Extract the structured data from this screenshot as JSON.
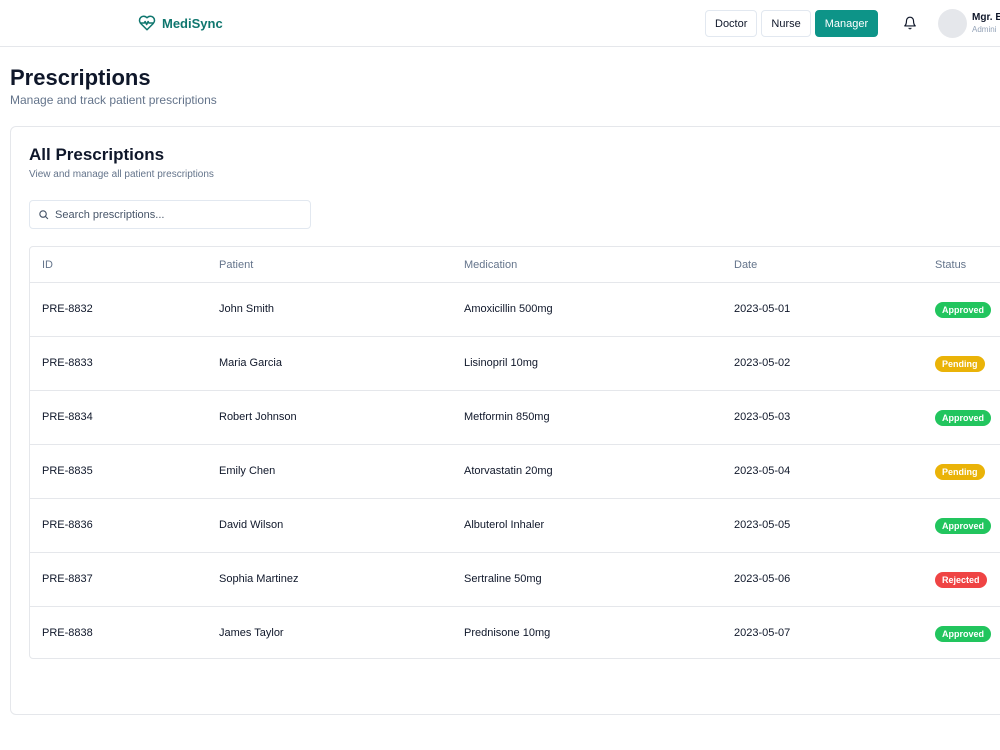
{
  "header": {
    "brand": "MediSync",
    "roles": [
      {
        "label": "Doctor",
        "active": false
      },
      {
        "label": "Nurse",
        "active": false
      },
      {
        "label": "Manager",
        "active": true
      }
    ],
    "user_name": "Mgr. E",
    "user_role": "Admini"
  },
  "page": {
    "title": "Prescriptions",
    "subtitle": "Manage and track patient prescriptions"
  },
  "card": {
    "title": "All Prescriptions",
    "subtitle": "View and manage all patient prescriptions",
    "search_placeholder": "Search prescriptions..."
  },
  "table": {
    "columns": [
      "ID",
      "Patient",
      "Medication",
      "Date",
      "Status"
    ],
    "rows": [
      {
        "id": "PRE-8832",
        "patient": "John Smith",
        "medication": "Amoxicillin 500mg",
        "date": "2023-05-01",
        "status": "Approved"
      },
      {
        "id": "PRE-8833",
        "patient": "Maria Garcia",
        "medication": "Lisinopril 10mg",
        "date": "2023-05-02",
        "status": "Pending"
      },
      {
        "id": "PRE-8834",
        "patient": "Robert Johnson",
        "medication": "Metformin 850mg",
        "date": "2023-05-03",
        "status": "Approved"
      },
      {
        "id": "PRE-8835",
        "patient": "Emily Chen",
        "medication": "Atorvastatin 20mg",
        "date": "2023-05-04",
        "status": "Pending"
      },
      {
        "id": "PRE-8836",
        "patient": "David Wilson",
        "medication": "Albuterol Inhaler",
        "date": "2023-05-05",
        "status": "Approved"
      },
      {
        "id": "PRE-8837",
        "patient": "Sophia Martinez",
        "medication": "Sertraline 50mg",
        "date": "2023-05-06",
        "status": "Rejected"
      },
      {
        "id": "PRE-8838",
        "patient": "James Taylor",
        "medication": "Prednisone 10mg",
        "date": "2023-05-07",
        "status": "Approved"
      }
    ]
  },
  "colors": {
    "brand": "#0f766e",
    "accent": "#0d9488",
    "approved": "#22c55e",
    "pending": "#eab308",
    "rejected": "#ef4444"
  },
  "icons": {
    "brand": "heart-pulse-icon",
    "notifications": "bell-icon",
    "search": "search-icon"
  }
}
